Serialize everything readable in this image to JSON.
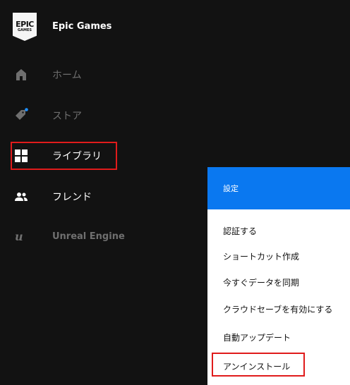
{
  "brand": {
    "name": "Epic Games",
    "logo_line1": "EPIC",
    "logo_line2": "GAMES"
  },
  "sidebar": {
    "items": [
      {
        "label": "ホーム",
        "icon": "home-icon",
        "state": "dim"
      },
      {
        "label": "ストア",
        "icon": "store-tag-icon",
        "state": "dim"
      },
      {
        "label": "ライブラリ",
        "icon": "library-grid-icon",
        "state": "active"
      },
      {
        "label": "フレンド",
        "icon": "friends-icon",
        "state": "normal"
      },
      {
        "label": "Unreal Engine",
        "icon": "unreal-engine-icon",
        "state": "dim"
      }
    ]
  },
  "context_menu": {
    "header": "設定",
    "items": [
      "認証する",
      "ショートカット作成",
      "今すぐデータを同期",
      "クラウドセーブを有効にする",
      "自動アップデート",
      "アンインストール"
    ]
  },
  "colors": {
    "background": "#121212",
    "accent_blue": "#0a78f0",
    "highlight_red": "#e01b1b",
    "store_dot": "#1e90ff"
  }
}
